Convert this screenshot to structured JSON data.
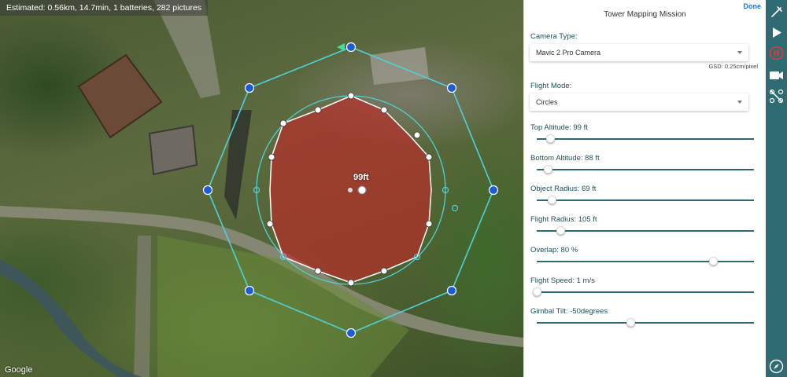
{
  "map": {
    "summary": "Estimated: 0.56km, 14.7min, 1 batteries, 282 pictures",
    "attribution": "Google",
    "altitude_label": "99ft"
  },
  "panel": {
    "done_label": "Done",
    "title": "Tower Mapping Mission",
    "camera": {
      "label": "Camera Type:",
      "value": "Mavic 2 Pro Camera",
      "gsd": "GSD: 0.25cm/pixel"
    },
    "flight_mode": {
      "label": "Flight Mode:",
      "value": "Circles"
    },
    "sliders": [
      {
        "label": "Top Altitude: 99 ft",
        "fraction": 0.06
      },
      {
        "label": "Bottom Altitude: 88 ft",
        "fraction": 0.05
      },
      {
        "label": "Object Radius: 69 ft",
        "fraction": 0.07
      },
      {
        "label": "Flight Radius: 105 ft",
        "fraction": 0.11
      },
      {
        "label": "Overlap: 80 %",
        "fraction": 0.81
      },
      {
        "label": "Flight Speed: 1 m/s",
        "fraction": 0.0
      },
      {
        "label": "Gimbal Tilt: -50degrees",
        "fraction": 0.43
      }
    ]
  },
  "rail": {
    "icons": [
      "wrench-icon",
      "play-icon",
      "pause-icon",
      "video-camera-icon",
      "drone-off-icon",
      "compass-icon"
    ],
    "accent": "#2f6b73",
    "stop_color": "#e53935"
  }
}
